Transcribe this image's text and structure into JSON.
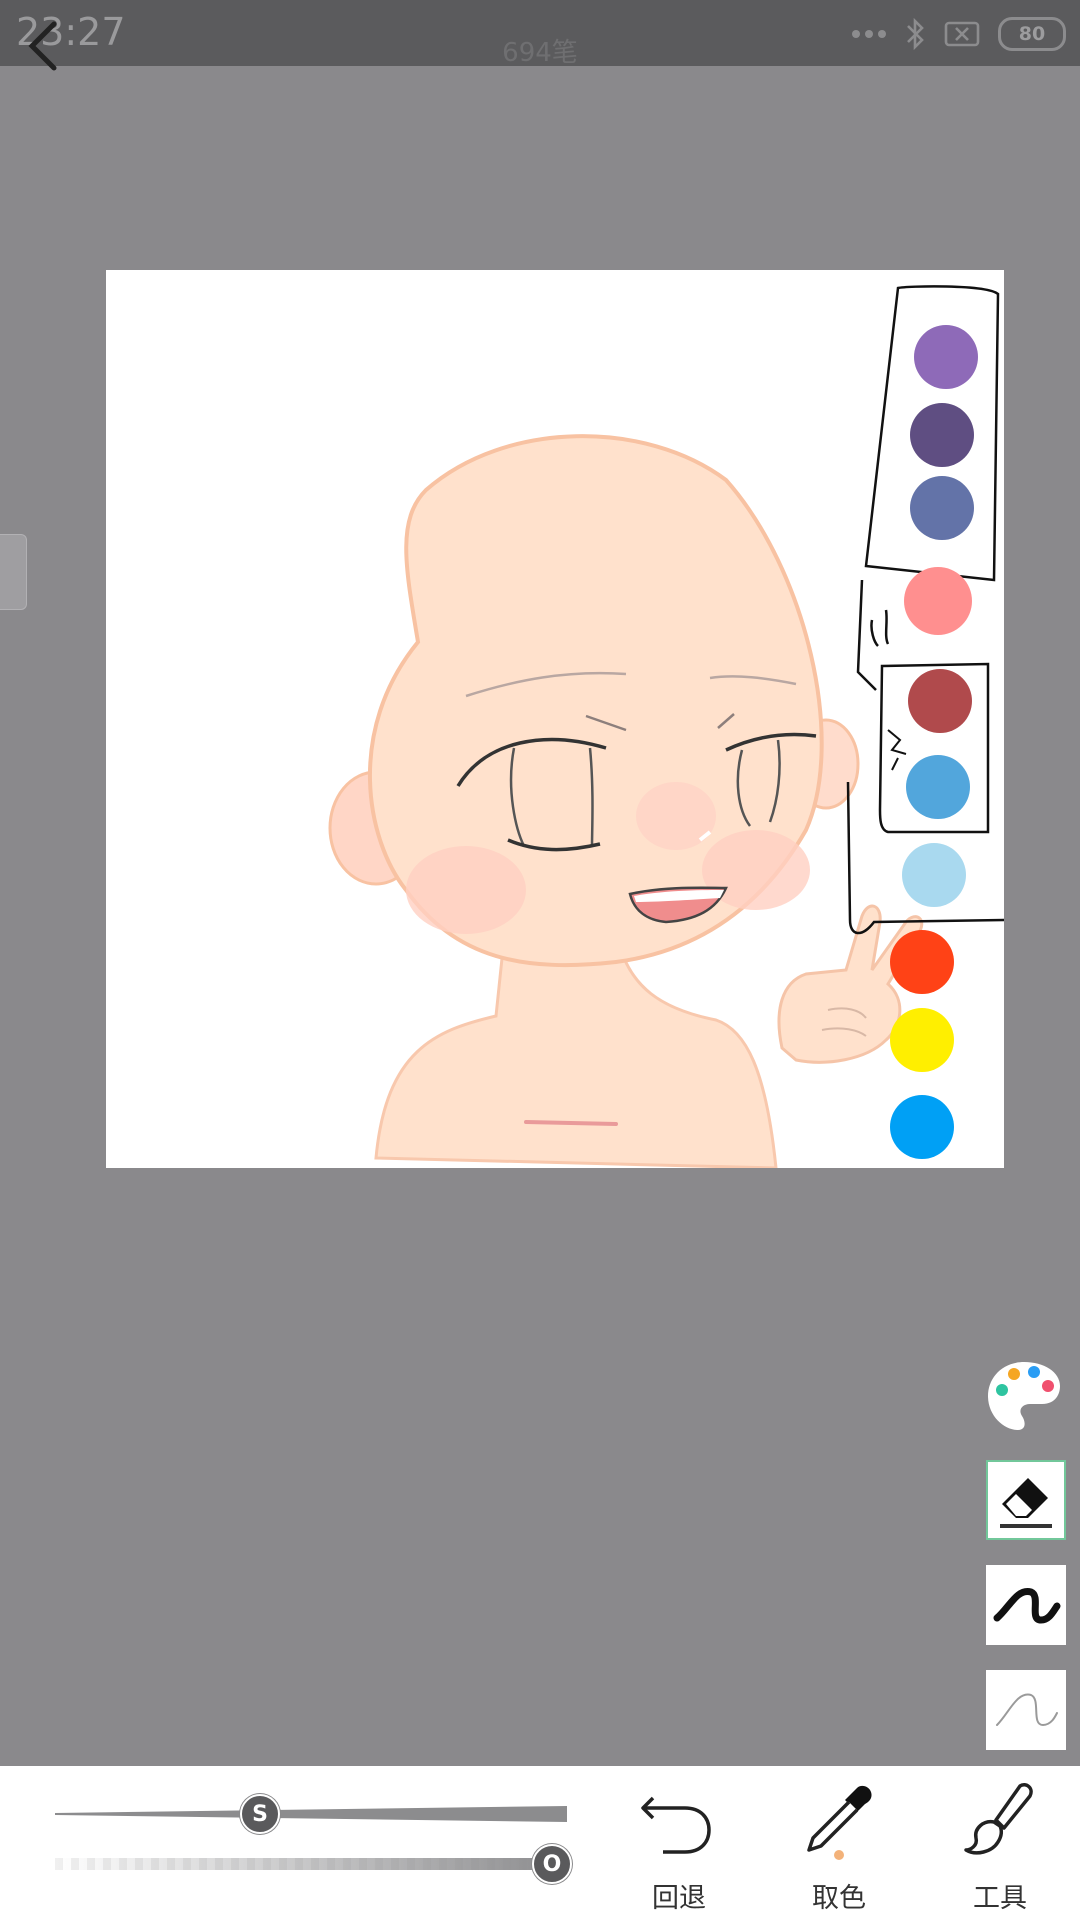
{
  "status_bar": {
    "time": "23:27",
    "battery": "80",
    "icons": [
      "more-dots-icon",
      "bluetooth-icon",
      "no-sim-icon",
      "battery-icon"
    ]
  },
  "header": {
    "stroke_count": "694笔",
    "back_icon": "back-arrow-icon"
  },
  "canvas": {
    "swatch_colors": [
      "#8e6ab8",
      "#5f4e82",
      "#6373a8",
      "#ff8f8f",
      "#b04a4c",
      "#52a6dc",
      "#a9d9ef",
      "#ff4216",
      "#ffef00",
      "#00a0f5"
    ],
    "skin_color": "#ffe1cc",
    "line_color": "#f8c2a2"
  },
  "right_tools": {
    "items": [
      "palette-icon",
      "eraser-icon",
      "thick-pen-icon",
      "thin-pen-icon"
    ],
    "selected": "eraser",
    "selected_border": "#72c79a"
  },
  "sliders": {
    "size_label": "S",
    "opacity_label": "O",
    "size_level": 0.33,
    "opacity_level": 1.0
  },
  "bottom_tools": {
    "undo_label": "回退",
    "picker_label": "取色",
    "tools_label": "工具"
  }
}
